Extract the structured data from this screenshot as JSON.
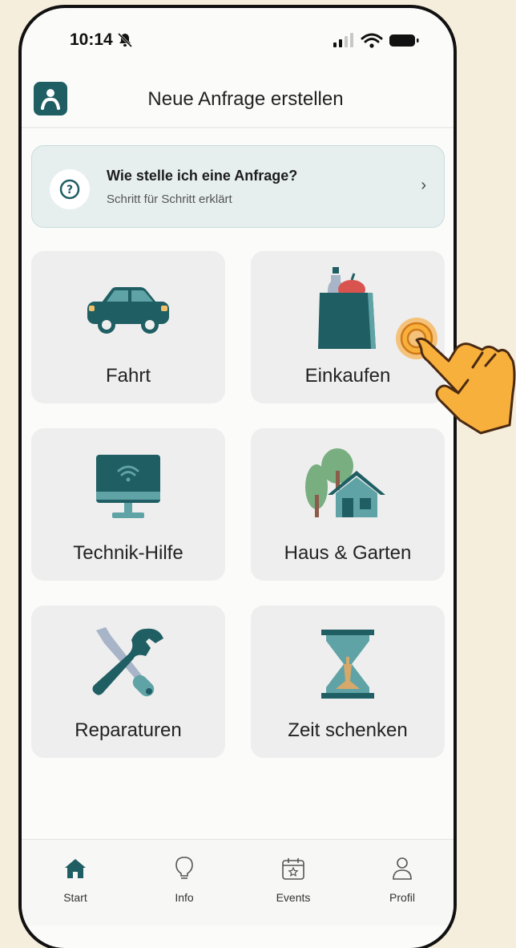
{
  "status_bar": {
    "time": "10:14"
  },
  "header": {
    "title": "Neue Anfrage erstellen"
  },
  "help_card": {
    "title": "Wie stelle ich eine Anfrage?",
    "subtitle": "Schritt für Schritt erklärt",
    "chevron": "›"
  },
  "tiles": [
    {
      "label": "Fahrt",
      "icon": "car-icon"
    },
    {
      "label": "Einkaufen",
      "icon": "shopping-bag-icon"
    },
    {
      "label": "Technik-Hilfe",
      "icon": "monitor-wifi-icon"
    },
    {
      "label": "Haus & Garten",
      "icon": "house-tree-icon"
    },
    {
      "label": "Reparaturen",
      "icon": "wrench-screwdriver-icon"
    },
    {
      "label": "Zeit schenken",
      "icon": "hourglass-icon"
    }
  ],
  "tabbar": {
    "items": [
      {
        "label": "Start",
        "icon": "home-icon"
      },
      {
        "label": "Info",
        "icon": "lightbulb-icon"
      },
      {
        "label": "Events",
        "icon": "calendar-star-icon"
      },
      {
        "label": "Profil",
        "icon": "user-icon"
      }
    ]
  },
  "colors": {
    "accent": "#1F5E63",
    "background": "#F6EEDC",
    "tile": "#EEEEEE"
  }
}
